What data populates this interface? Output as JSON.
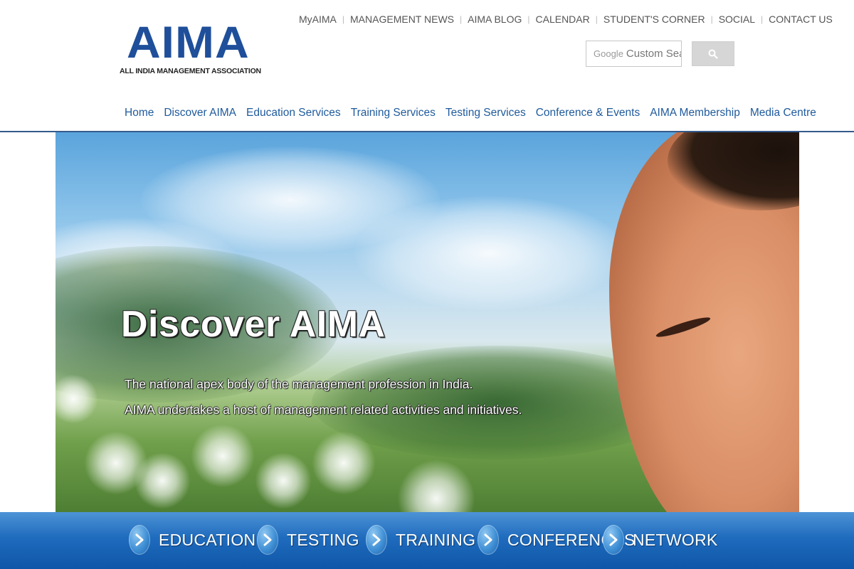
{
  "logo": {
    "mark": "AIMA",
    "tagline": "ALL INDIA MANAGEMENT ASSOCIATION"
  },
  "top_links": [
    {
      "label": "MyAIMA"
    },
    {
      "label": "MANAGEMENT NEWS"
    },
    {
      "label": "AIMA BLOG"
    },
    {
      "label": "CALENDAR"
    },
    {
      "label": "STUDENT'S CORNER"
    },
    {
      "label": "SOCIAL"
    },
    {
      "label": "CONTACT US"
    }
  ],
  "search": {
    "brand": "Google",
    "placeholder": "Custom Sear",
    "button_icon": "search-icon"
  },
  "main_nav": [
    {
      "label": "Home"
    },
    {
      "label": "Discover AIMA"
    },
    {
      "label": "Education Services"
    },
    {
      "label": "Training Services"
    },
    {
      "label": "Testing Services"
    },
    {
      "label": "Conference & Events"
    },
    {
      "label": "AIMA Membership"
    },
    {
      "label": "Media Centre"
    }
  ],
  "hero": {
    "title": "Discover AIMA",
    "line1": "The national apex body of the management profession in India.",
    "line2": "AIMA undertakes a host of management related activities and initiatives."
  },
  "quick_links": [
    {
      "label": "EDUCATION",
      "icon": "chevron-right-icon"
    },
    {
      "label": "TESTING",
      "icon": "chevron-right-icon"
    },
    {
      "label": "TRAINING",
      "icon": "chevron-right-icon"
    },
    {
      "label": "CONFERENCES",
      "icon": "chevron-right-icon"
    },
    {
      "label": "NETWORK",
      "icon": "chevron-right-icon"
    }
  ],
  "colors": {
    "brand_blue": "#1f4f9a",
    "nav_link": "#1f5a9c",
    "bottom_bar": "#1f6bbd"
  }
}
